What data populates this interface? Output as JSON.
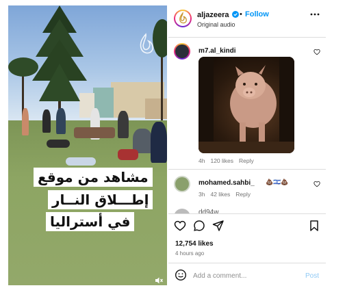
{
  "video": {
    "caption_lines": [
      "مشاهد من موقع",
      "إطـــلاق النــار",
      "في أستراليا"
    ]
  },
  "header": {
    "username": "aljazeera",
    "separator": "•",
    "follow_label": "Follow",
    "audio_label": "Original audio"
  },
  "comments": [
    {
      "username": "m7.al_kindi",
      "age": "4h",
      "likes": "120 likes",
      "reply_label": "Reply"
    },
    {
      "username": "mohamed.sahbi_",
      "emojis": "💩🇮🇱💩",
      "age": "3h",
      "likes": "42 likes",
      "reply_label": "Reply"
    },
    {
      "username": "dd94w"
    }
  ],
  "footer": {
    "likes_count": "12,754 likes",
    "time_ago": "4 hours ago",
    "comment_placeholder": "Add a comment...",
    "post_label": "Post"
  },
  "colors": {
    "follow_blue": "#0095f6",
    "post_disabled_blue": "#8fc9f5",
    "muted_text": "#737373"
  },
  "icons": [
    "verified-icon",
    "more-options-icon",
    "heart-icon",
    "comment-icon",
    "share-icon",
    "bookmark-icon",
    "emoji-icon",
    "muted-icon"
  ]
}
